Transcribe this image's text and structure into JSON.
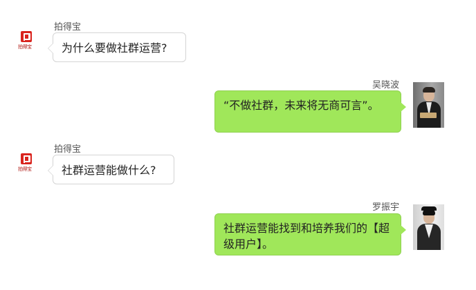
{
  "chat": {
    "messages": [
      {
        "sender": "拍得宝",
        "logo_text": "拍得宝",
        "text": "为什么要做社群运营?",
        "side": "left"
      },
      {
        "sender": "吴晓波",
        "text": "“不做社群，未来将无商可言”。",
        "side": "right"
      },
      {
        "sender": "拍得宝",
        "logo_text": "拍得宝",
        "text": "社群运营能做什么?",
        "side": "left"
      },
      {
        "sender": "罗振宇",
        "text": "社群运营能找到和培养我们的【超级用户】。",
        "side": "right"
      }
    ]
  },
  "colors": {
    "left_bubble_bg": "#ffffff",
    "left_bubble_border": "#d4d4d4",
    "right_bubble_bg": "#a0e75a",
    "brand_red": "#d9231d"
  }
}
